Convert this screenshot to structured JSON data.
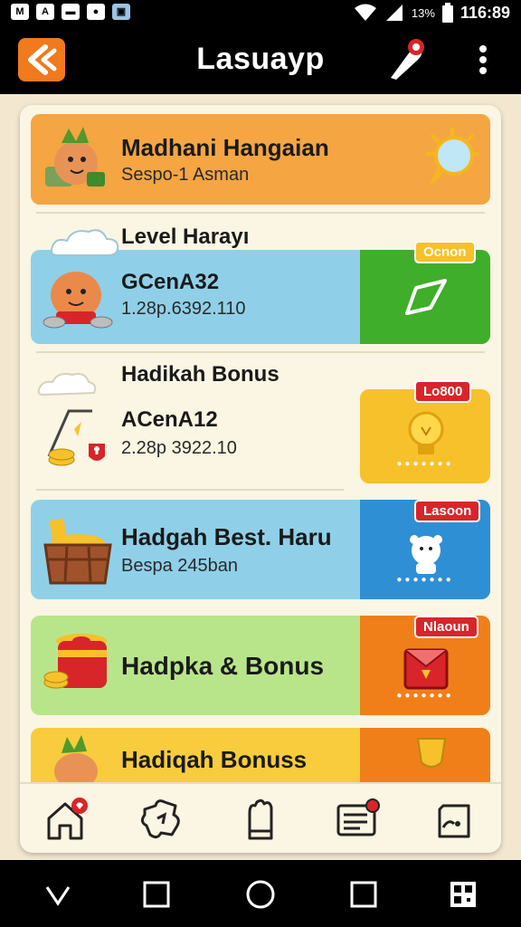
{
  "status": {
    "battery_text": "13%",
    "time": "116:89"
  },
  "appbar": {
    "title": "Lasuayp"
  },
  "cards": [
    {
      "title": "Madhani Hangaian",
      "subtitle": "Sespo-1 Asman"
    },
    {
      "title": "Level Harayı",
      "name": "GCenA32",
      "sub": "1.28p.6392.110",
      "tag": "Ocnon"
    },
    {
      "title": "Hadikah Bonus",
      "name": "ACenA12",
      "sub": "2.28p 3922.10",
      "tag": "Lo800"
    },
    {
      "title": "Hadgah Best. Haru",
      "subtitle": "Bespa 245ban",
      "tag": "Lasoon"
    },
    {
      "title": "Hadpka & Bonus",
      "tag": "Nlaoun"
    },
    {
      "title": "Hadiqah Bonuss"
    }
  ],
  "colors": {
    "orange_card": "#f5a542",
    "blue_card": "#8fd0e8",
    "green_action": "#3fae2a",
    "yellow_action": "#f6c12a",
    "blue_action": "#2f8fd4",
    "lime_card": "#b8e58a",
    "orange_action": "#f07f1a",
    "yellow_card": "#f8cc3c",
    "accent": "#f07a1c"
  },
  "icons": [
    "back-arrow-icon",
    "rocket-icon",
    "more-vertical-icon",
    "home-icon",
    "puzzle-icon",
    "glove-icon",
    "message-icon",
    "wallet-icon"
  ]
}
